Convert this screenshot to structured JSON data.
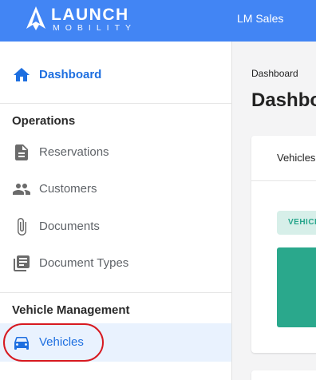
{
  "brand": {
    "name": "LAUNCH",
    "sub": "MOBILITY"
  },
  "header": {
    "org_name": "LM Sales"
  },
  "sidebar": {
    "dashboard": {
      "label": "Dashboard",
      "icon": "home-icon"
    },
    "sections": [
      {
        "title": "Operations",
        "items": [
          {
            "label": "Reservations",
            "icon": "document-icon"
          },
          {
            "label": "Customers",
            "icon": "people-icon"
          },
          {
            "label": "Documents",
            "icon": "paperclip-icon"
          },
          {
            "label": "Document Types",
            "icon": "library-icon"
          }
        ]
      },
      {
        "title": "Vehicle Management",
        "items": [
          {
            "label": "Vehicles",
            "icon": "car-icon",
            "active": true
          }
        ]
      }
    ]
  },
  "main": {
    "breadcrumb": "Dashboard",
    "title": "Dashboard",
    "card": {
      "tab_label": "Vehicles",
      "chip_label": "VEHICLES"
    }
  },
  "colors": {
    "header_bg": "#4285f4",
    "accent": "#1e6fe0",
    "teal": "#2aa88c",
    "annotation_ring": "#d71920"
  }
}
